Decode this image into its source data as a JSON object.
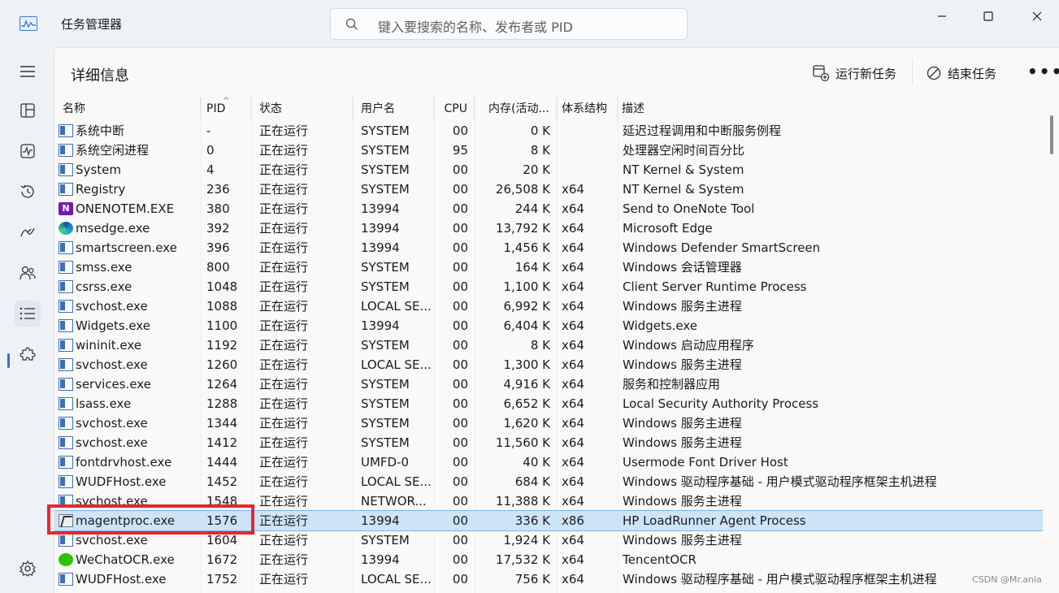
{
  "window": {
    "title": "任务管理器",
    "search_placeholder": "键入要搜索的名称、发布者或 PID"
  },
  "page": {
    "title": "详细信息",
    "run_new_task": "运行新任务",
    "end_task": "结束任务",
    "more": "•••"
  },
  "columns": [
    "名称",
    "PID",
    "状态",
    "用户名",
    "CPU",
    "内存(活动...",
    "体系结构",
    "描述"
  ],
  "rows": [
    {
      "icon": "win",
      "name": "系统中断",
      "pid": "-",
      "status": "正在运行",
      "user": "SYSTEM",
      "cpu": "00",
      "mem": "0 K",
      "arch": "",
      "desc": "延迟过程调用和中断服务例程"
    },
    {
      "icon": "win",
      "name": "系统空闲进程",
      "pid": "0",
      "status": "正在运行",
      "user": "SYSTEM",
      "cpu": "95",
      "mem": "8 K",
      "arch": "",
      "desc": "处理器空闲时间百分比"
    },
    {
      "icon": "win",
      "name": "System",
      "pid": "4",
      "status": "正在运行",
      "user": "SYSTEM",
      "cpu": "00",
      "mem": "20 K",
      "arch": "",
      "desc": "NT Kernel & System"
    },
    {
      "icon": "win",
      "name": "Registry",
      "pid": "236",
      "status": "正在运行",
      "user": "SYSTEM",
      "cpu": "00",
      "mem": "26,508 K",
      "arch": "x64",
      "desc": "NT Kernel & System"
    },
    {
      "icon": "onenote",
      "name": "ONENOTEM.EXE",
      "pid": "380",
      "status": "正在运行",
      "user": "13994",
      "cpu": "00",
      "mem": "244 K",
      "arch": "x64",
      "desc": "Send to OneNote Tool"
    },
    {
      "icon": "edge",
      "name": "msedge.exe",
      "pid": "392",
      "status": "正在运行",
      "user": "13994",
      "cpu": "00",
      "mem": "13,792 K",
      "arch": "x64",
      "desc": "Microsoft Edge"
    },
    {
      "icon": "win",
      "name": "smartscreen.exe",
      "pid": "396",
      "status": "正在运行",
      "user": "13994",
      "cpu": "00",
      "mem": "1,456 K",
      "arch": "x64",
      "desc": "Windows Defender SmartScreen"
    },
    {
      "icon": "win",
      "name": "smss.exe",
      "pid": "800",
      "status": "正在运行",
      "user": "SYSTEM",
      "cpu": "00",
      "mem": "164 K",
      "arch": "x64",
      "desc": "Windows 会话管理器"
    },
    {
      "icon": "win",
      "name": "csrss.exe",
      "pid": "1048",
      "status": "正在运行",
      "user": "SYSTEM",
      "cpu": "00",
      "mem": "1,100 K",
      "arch": "x64",
      "desc": "Client Server Runtime Process"
    },
    {
      "icon": "win",
      "name": "svchost.exe",
      "pid": "1088",
      "status": "正在运行",
      "user": "LOCAL SE...",
      "cpu": "00",
      "mem": "6,992 K",
      "arch": "x64",
      "desc": "Windows 服务主进程"
    },
    {
      "icon": "win",
      "name": "Widgets.exe",
      "pid": "1100",
      "status": "正在运行",
      "user": "13994",
      "cpu": "00",
      "mem": "6,404 K",
      "arch": "x64",
      "desc": "Widgets.exe"
    },
    {
      "icon": "win",
      "name": "wininit.exe",
      "pid": "1192",
      "status": "正在运行",
      "user": "SYSTEM",
      "cpu": "00",
      "mem": "8 K",
      "arch": "x64",
      "desc": "Windows 启动应用程序"
    },
    {
      "icon": "win",
      "name": "svchost.exe",
      "pid": "1260",
      "status": "正在运行",
      "user": "LOCAL SE...",
      "cpu": "00",
      "mem": "1,300 K",
      "arch": "x64",
      "desc": "Windows 服务主进程"
    },
    {
      "icon": "win",
      "name": "services.exe",
      "pid": "1264",
      "status": "正在运行",
      "user": "SYSTEM",
      "cpu": "00",
      "mem": "4,916 K",
      "arch": "x64",
      "desc": "服务和控制器应用"
    },
    {
      "icon": "win",
      "name": "lsass.exe",
      "pid": "1288",
      "status": "正在运行",
      "user": "SYSTEM",
      "cpu": "00",
      "mem": "6,652 K",
      "arch": "x64",
      "desc": "Local Security Authority Process"
    },
    {
      "icon": "win",
      "name": "svchost.exe",
      "pid": "1344",
      "status": "正在运行",
      "user": "SYSTEM",
      "cpu": "00",
      "mem": "1,620 K",
      "arch": "x64",
      "desc": "Windows 服务主进程"
    },
    {
      "icon": "win",
      "name": "svchost.exe",
      "pid": "1412",
      "status": "正在运行",
      "user": "SYSTEM",
      "cpu": "00",
      "mem": "11,560 K",
      "arch": "x64",
      "desc": "Windows 服务主进程"
    },
    {
      "icon": "win",
      "name": "fontdrvhost.exe",
      "pid": "1444",
      "status": "正在运行",
      "user": "UMFD-0",
      "cpu": "00",
      "mem": "40 K",
      "arch": "x64",
      "desc": "Usermode Font Driver Host"
    },
    {
      "icon": "win",
      "name": "WUDFHost.exe",
      "pid": "1452",
      "status": "正在运行",
      "user": "LOCAL SE...",
      "cpu": "00",
      "mem": "684 K",
      "arch": "x64",
      "desc": "Windows 驱动程序基础 - 用户模式驱动程序框架主机进程"
    },
    {
      "icon": "win",
      "name": "svchost.exe",
      "pid": "1548",
      "status": "正在运行",
      "user": "NETWOR...",
      "cpu": "00",
      "mem": "11,388 K",
      "arch": "x64",
      "desc": "Windows 服务主进程"
    },
    {
      "icon": "loadrunner",
      "name": "magentproc.exe",
      "pid": "1576",
      "status": "正在运行",
      "user": "13994",
      "cpu": "00",
      "mem": "336 K",
      "arch": "x86",
      "desc": "HP LoadRunner Agent Process",
      "selected": true
    },
    {
      "icon": "win",
      "name": "svchost.exe",
      "pid": "1604",
      "status": "正在运行",
      "user": "SYSTEM",
      "cpu": "00",
      "mem": "1,924 K",
      "arch": "x64",
      "desc": "Windows 服务主进程"
    },
    {
      "icon": "wechat",
      "name": "WeChatOCR.exe",
      "pid": "1672",
      "status": "正在运行",
      "user": "13994",
      "cpu": "00",
      "mem": "17,532 K",
      "arch": "x64",
      "desc": "TencentOCR"
    },
    {
      "icon": "win",
      "name": "WUDFHost.exe",
      "pid": "1752",
      "status": "正在运行",
      "user": "LOCAL SE...",
      "cpu": "00",
      "mem": "756 K",
      "arch": "x64",
      "desc": "Windows 驱动程序基础 - 用户模式驱动程序框架主机进程"
    }
  ],
  "watermark": "CSDN @Mr.anla"
}
